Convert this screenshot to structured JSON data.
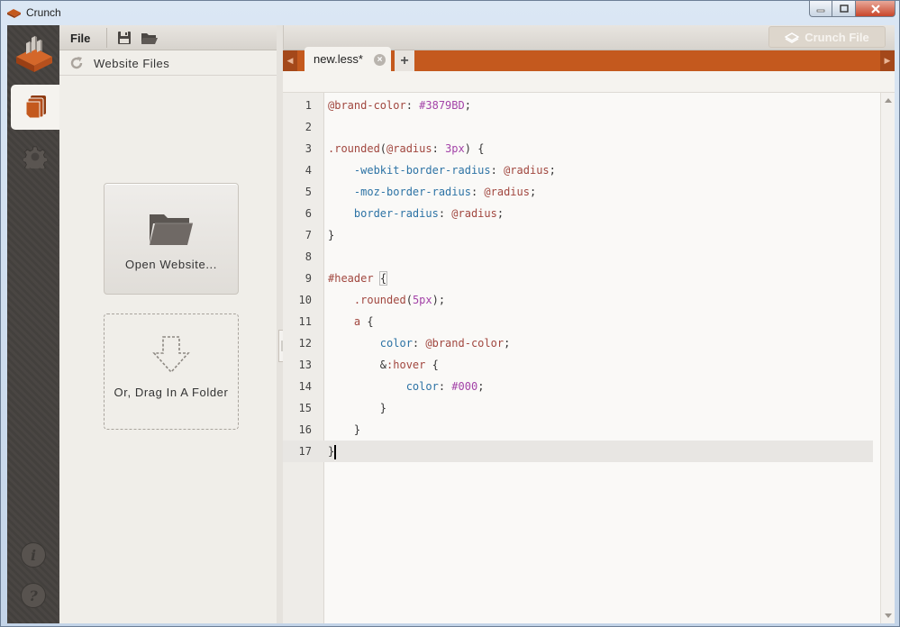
{
  "window": {
    "title": "Crunch"
  },
  "toolbar": {
    "menu_file": "File",
    "crunch_button": "Crunch File"
  },
  "panel": {
    "title": "Website Files",
    "open_website": "Open Website...",
    "drag_folder": "Or, Drag In A Folder"
  },
  "tabs": [
    {
      "label": "new.less*"
    }
  ],
  "editor": {
    "active_line": 17,
    "lines": [
      {
        "n": "1",
        "tokens": [
          [
            "t-var",
            "@brand-color"
          ],
          [
            "",
            ""
          ],
          [
            "",
            ": "
          ],
          [
            "t-num",
            "#3879BD"
          ],
          [
            "",
            ";"
          ]
        ]
      },
      {
        "n": "2",
        "tokens": []
      },
      {
        "n": "3",
        "tokens": [
          [
            "t-sel",
            ".rounded"
          ],
          [
            "",
            "("
          ],
          [
            "t-var",
            "@radius"
          ],
          [
            "",
            ": "
          ],
          [
            "t-num",
            "3px"
          ],
          [
            "",
            ") {"
          ]
        ]
      },
      {
        "n": "4",
        "tokens": [
          [
            "",
            "    "
          ],
          [
            "t-prop",
            "-webkit-border-radius"
          ],
          [
            "",
            ": "
          ],
          [
            "t-var",
            "@radius"
          ],
          [
            "",
            ";"
          ]
        ]
      },
      {
        "n": "5",
        "tokens": [
          [
            "",
            "    "
          ],
          [
            "t-prop",
            "-moz-border-radius"
          ],
          [
            "",
            ": "
          ],
          [
            "t-var",
            "@radius"
          ],
          [
            "",
            ";"
          ]
        ]
      },
      {
        "n": "6",
        "tokens": [
          [
            "",
            "    "
          ],
          [
            "t-prop",
            "border-radius"
          ],
          [
            "",
            ": "
          ],
          [
            "t-var",
            "@radius"
          ],
          [
            "",
            ";"
          ]
        ]
      },
      {
        "n": "7",
        "tokens": [
          [
            "",
            "}"
          ]
        ]
      },
      {
        "n": "8",
        "tokens": []
      },
      {
        "n": "9",
        "tokens": [
          [
            "t-sel",
            "#header"
          ],
          [
            "",
            ""
          ],
          [
            "bracket",
            " {"
          ]
        ]
      },
      {
        "n": "10",
        "tokens": [
          [
            "",
            "    "
          ],
          [
            "t-sel",
            ".rounded"
          ],
          [
            "",
            "("
          ],
          [
            "t-num",
            "5px"
          ],
          [
            "",
            ");"
          ]
        ]
      },
      {
        "n": "11",
        "tokens": [
          [
            "",
            "    "
          ],
          [
            "t-sel",
            "a"
          ],
          [
            "",
            ""
          ],
          [
            "",
            " {"
          ]
        ]
      },
      {
        "n": "12",
        "tokens": [
          [
            "",
            "        "
          ],
          [
            "t-prop",
            "color"
          ],
          [
            "",
            ": "
          ],
          [
            "t-var",
            "@brand-color"
          ],
          [
            "",
            ";"
          ]
        ]
      },
      {
        "n": "13",
        "tokens": [
          [
            "",
            "        "
          ],
          [
            "t-amp",
            "&"
          ],
          [
            "t-sel",
            ":hover"
          ],
          [
            "",
            ""
          ],
          [
            "",
            " {"
          ]
        ]
      },
      {
        "n": "14",
        "tokens": [
          [
            "",
            "            "
          ],
          [
            "t-prop",
            "color"
          ],
          [
            "",
            ": "
          ],
          [
            "t-num",
            "#000"
          ],
          [
            "",
            ";"
          ]
        ]
      },
      {
        "n": "15",
        "tokens": [
          [
            "",
            "        }"
          ]
        ]
      },
      {
        "n": "16",
        "tokens": [
          [
            "",
            "    }"
          ]
        ]
      },
      {
        "n": "17",
        "tokens": [
          [
            "",
            "}"
          ]
        ]
      }
    ]
  },
  "icons": {
    "logo": "crunch-logo-icon",
    "files_tab": "files-icon",
    "settings": "gear-icon",
    "info": "info-icon",
    "help": "help-icon",
    "save": "save-icon",
    "open": "folder-open-icon",
    "refresh": "refresh-icon"
  },
  "colors": {
    "accent": "#C4591E",
    "rail": "#4A4643"
  }
}
